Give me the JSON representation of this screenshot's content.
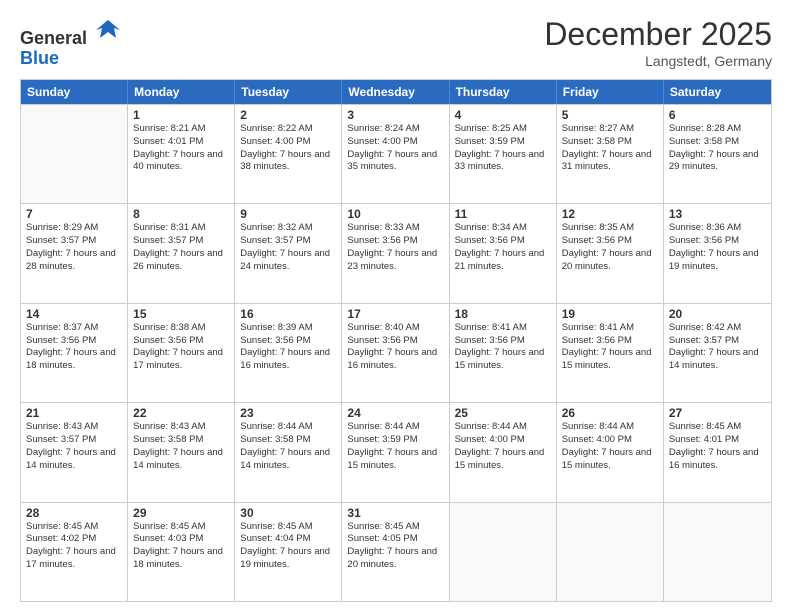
{
  "header": {
    "logo_line1": "General",
    "logo_line2": "Blue",
    "month": "December 2025",
    "location": "Langstedt, Germany"
  },
  "weekdays": [
    "Sunday",
    "Monday",
    "Tuesday",
    "Wednesday",
    "Thursday",
    "Friday",
    "Saturday"
  ],
  "weeks": [
    [
      {
        "day": "",
        "sunrise": "",
        "sunset": "",
        "daylight": ""
      },
      {
        "day": "1",
        "sunrise": "Sunrise: 8:21 AM",
        "sunset": "Sunset: 4:01 PM",
        "daylight": "Daylight: 7 hours and 40 minutes."
      },
      {
        "day": "2",
        "sunrise": "Sunrise: 8:22 AM",
        "sunset": "Sunset: 4:00 PM",
        "daylight": "Daylight: 7 hours and 38 minutes."
      },
      {
        "day": "3",
        "sunrise": "Sunrise: 8:24 AM",
        "sunset": "Sunset: 4:00 PM",
        "daylight": "Daylight: 7 hours and 35 minutes."
      },
      {
        "day": "4",
        "sunrise": "Sunrise: 8:25 AM",
        "sunset": "Sunset: 3:59 PM",
        "daylight": "Daylight: 7 hours and 33 minutes."
      },
      {
        "day": "5",
        "sunrise": "Sunrise: 8:27 AM",
        "sunset": "Sunset: 3:58 PM",
        "daylight": "Daylight: 7 hours and 31 minutes."
      },
      {
        "day": "6",
        "sunrise": "Sunrise: 8:28 AM",
        "sunset": "Sunset: 3:58 PM",
        "daylight": "Daylight: 7 hours and 29 minutes."
      }
    ],
    [
      {
        "day": "7",
        "sunrise": "Sunrise: 8:29 AM",
        "sunset": "Sunset: 3:57 PM",
        "daylight": "Daylight: 7 hours and 28 minutes."
      },
      {
        "day": "8",
        "sunrise": "Sunrise: 8:31 AM",
        "sunset": "Sunset: 3:57 PM",
        "daylight": "Daylight: 7 hours and 26 minutes."
      },
      {
        "day": "9",
        "sunrise": "Sunrise: 8:32 AM",
        "sunset": "Sunset: 3:57 PM",
        "daylight": "Daylight: 7 hours and 24 minutes."
      },
      {
        "day": "10",
        "sunrise": "Sunrise: 8:33 AM",
        "sunset": "Sunset: 3:56 PM",
        "daylight": "Daylight: 7 hours and 23 minutes."
      },
      {
        "day": "11",
        "sunrise": "Sunrise: 8:34 AM",
        "sunset": "Sunset: 3:56 PM",
        "daylight": "Daylight: 7 hours and 21 minutes."
      },
      {
        "day": "12",
        "sunrise": "Sunrise: 8:35 AM",
        "sunset": "Sunset: 3:56 PM",
        "daylight": "Daylight: 7 hours and 20 minutes."
      },
      {
        "day": "13",
        "sunrise": "Sunrise: 8:36 AM",
        "sunset": "Sunset: 3:56 PM",
        "daylight": "Daylight: 7 hours and 19 minutes."
      }
    ],
    [
      {
        "day": "14",
        "sunrise": "Sunrise: 8:37 AM",
        "sunset": "Sunset: 3:56 PM",
        "daylight": "Daylight: 7 hours and 18 minutes."
      },
      {
        "day": "15",
        "sunrise": "Sunrise: 8:38 AM",
        "sunset": "Sunset: 3:56 PM",
        "daylight": "Daylight: 7 hours and 17 minutes."
      },
      {
        "day": "16",
        "sunrise": "Sunrise: 8:39 AM",
        "sunset": "Sunset: 3:56 PM",
        "daylight": "Daylight: 7 hours and 16 minutes."
      },
      {
        "day": "17",
        "sunrise": "Sunrise: 8:40 AM",
        "sunset": "Sunset: 3:56 PM",
        "daylight": "Daylight: 7 hours and 16 minutes."
      },
      {
        "day": "18",
        "sunrise": "Sunrise: 8:41 AM",
        "sunset": "Sunset: 3:56 PM",
        "daylight": "Daylight: 7 hours and 15 minutes."
      },
      {
        "day": "19",
        "sunrise": "Sunrise: 8:41 AM",
        "sunset": "Sunset: 3:56 PM",
        "daylight": "Daylight: 7 hours and 15 minutes."
      },
      {
        "day": "20",
        "sunrise": "Sunrise: 8:42 AM",
        "sunset": "Sunset: 3:57 PM",
        "daylight": "Daylight: 7 hours and 14 minutes."
      }
    ],
    [
      {
        "day": "21",
        "sunrise": "Sunrise: 8:43 AM",
        "sunset": "Sunset: 3:57 PM",
        "daylight": "Daylight: 7 hours and 14 minutes."
      },
      {
        "day": "22",
        "sunrise": "Sunrise: 8:43 AM",
        "sunset": "Sunset: 3:58 PM",
        "daylight": "Daylight: 7 hours and 14 minutes."
      },
      {
        "day": "23",
        "sunrise": "Sunrise: 8:44 AM",
        "sunset": "Sunset: 3:58 PM",
        "daylight": "Daylight: 7 hours and 14 minutes."
      },
      {
        "day": "24",
        "sunrise": "Sunrise: 8:44 AM",
        "sunset": "Sunset: 3:59 PM",
        "daylight": "Daylight: 7 hours and 15 minutes."
      },
      {
        "day": "25",
        "sunrise": "Sunrise: 8:44 AM",
        "sunset": "Sunset: 4:00 PM",
        "daylight": "Daylight: 7 hours and 15 minutes."
      },
      {
        "day": "26",
        "sunrise": "Sunrise: 8:44 AM",
        "sunset": "Sunset: 4:00 PM",
        "daylight": "Daylight: 7 hours and 15 minutes."
      },
      {
        "day": "27",
        "sunrise": "Sunrise: 8:45 AM",
        "sunset": "Sunset: 4:01 PM",
        "daylight": "Daylight: 7 hours and 16 minutes."
      }
    ],
    [
      {
        "day": "28",
        "sunrise": "Sunrise: 8:45 AM",
        "sunset": "Sunset: 4:02 PM",
        "daylight": "Daylight: 7 hours and 17 minutes."
      },
      {
        "day": "29",
        "sunrise": "Sunrise: 8:45 AM",
        "sunset": "Sunset: 4:03 PM",
        "daylight": "Daylight: 7 hours and 18 minutes."
      },
      {
        "day": "30",
        "sunrise": "Sunrise: 8:45 AM",
        "sunset": "Sunset: 4:04 PM",
        "daylight": "Daylight: 7 hours and 19 minutes."
      },
      {
        "day": "31",
        "sunrise": "Sunrise: 8:45 AM",
        "sunset": "Sunset: 4:05 PM",
        "daylight": "Daylight: 7 hours and 20 minutes."
      },
      {
        "day": "",
        "sunrise": "",
        "sunset": "",
        "daylight": ""
      },
      {
        "day": "",
        "sunrise": "",
        "sunset": "",
        "daylight": ""
      },
      {
        "day": "",
        "sunrise": "",
        "sunset": "",
        "daylight": ""
      }
    ]
  ]
}
